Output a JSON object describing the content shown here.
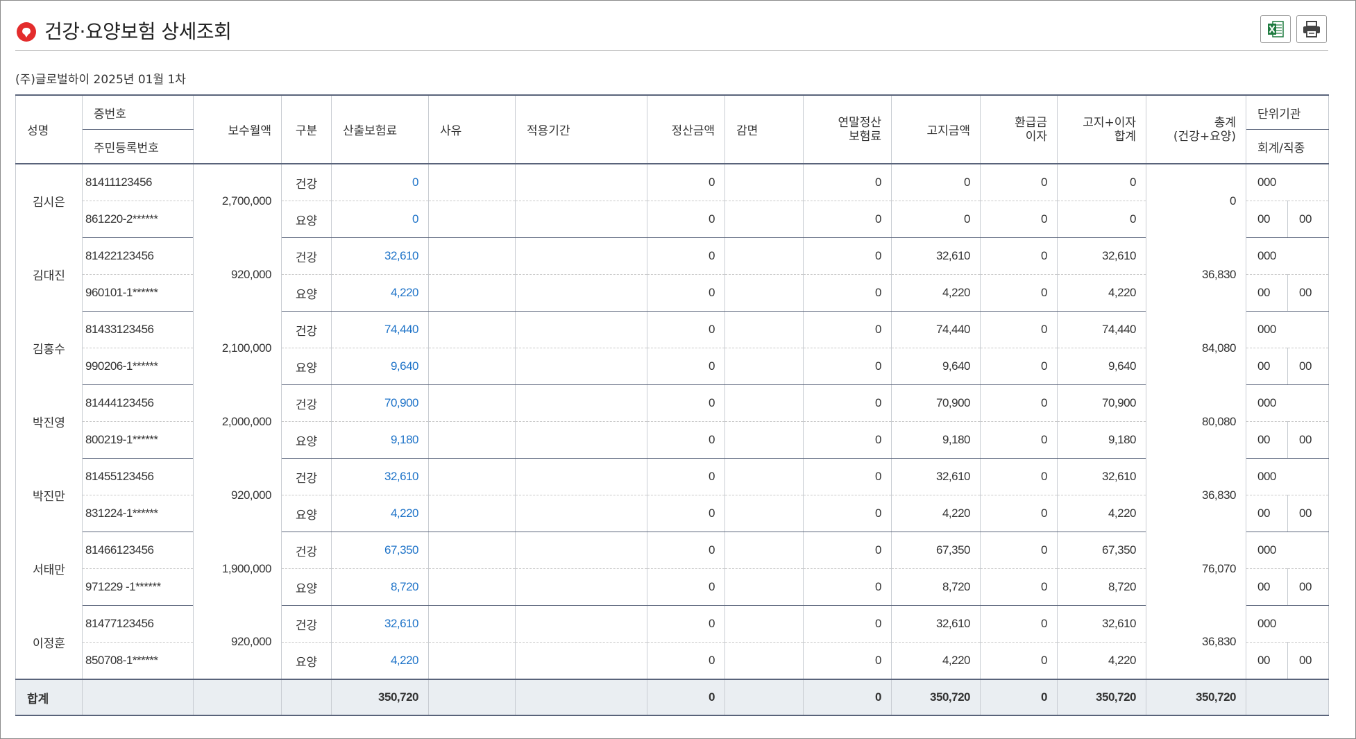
{
  "page": {
    "title": "건강·요양보험 상세조회",
    "subtitle": "(주)글로벌하이 2025년 01월 1차",
    "excel_label": "Excel",
    "print_label": "Print"
  },
  "headers": {
    "name": "성명",
    "card_no": "증번호",
    "resident_no": "주민등록번호",
    "monthly_pay": "보수월액",
    "category": "구분",
    "calc_premium": "산출보험료",
    "reason": "사유",
    "period": "적용기간",
    "settle_amount": "정산금액",
    "reduction": "감면",
    "yearend_l1": "연말정산",
    "yearend_l2": "보험료",
    "notice_amount": "고지금액",
    "refund_l1": "환급금",
    "refund_l2": "이자",
    "notice_interest_l1": "고지+이자",
    "notice_interest_l2": "합계",
    "total_l1": "총계",
    "total_l2": "(건강+요양)",
    "unit_org": "단위기관",
    "account_type": "회계/직종"
  },
  "rows": [
    {
      "name": "김시은",
      "card": "81411123456",
      "rrn": "861220-2******",
      "pay": "2,700,000",
      "h_cat": "건강",
      "h_calc": "0",
      "h_settle": "0",
      "h_year": "0",
      "h_notice": "0",
      "h_refund": "0",
      "h_sum": "0",
      "l_cat": "요양",
      "l_calc": "0",
      "l_settle": "0",
      "l_year": "0",
      "l_notice": "0",
      "l_refund": "0",
      "l_sum": "0",
      "total": "0",
      "unit": "000",
      "acc1": "00",
      "acc2": "00"
    },
    {
      "name": "김대진",
      "card": "81422123456",
      "rrn": "960101-1******",
      "pay": "920,000",
      "h_cat": "건강",
      "h_calc": "32,610",
      "h_settle": "0",
      "h_year": "0",
      "h_notice": "32,610",
      "h_refund": "0",
      "h_sum": "32,610",
      "l_cat": "요양",
      "l_calc": "4,220",
      "l_settle": "0",
      "l_year": "0",
      "l_notice": "4,220",
      "l_refund": "0",
      "l_sum": "4,220",
      "total": "36,830",
      "unit": "000",
      "acc1": "00",
      "acc2": "00"
    },
    {
      "name": "김홍수",
      "card": "81433123456",
      "rrn": "990206-1******",
      "pay": "2,100,000",
      "h_cat": "건강",
      "h_calc": "74,440",
      "h_settle": "0",
      "h_year": "0",
      "h_notice": "74,440",
      "h_refund": "0",
      "h_sum": "74,440",
      "l_cat": "요양",
      "l_calc": "9,640",
      "l_settle": "0",
      "l_year": "0",
      "l_notice": "9,640",
      "l_refund": "0",
      "l_sum": "9,640",
      "total": "84,080",
      "unit": "000",
      "acc1": "00",
      "acc2": "00"
    },
    {
      "name": "박진영",
      "card": "81444123456",
      "rrn": "800219-1******",
      "pay": "2,000,000",
      "h_cat": "건강",
      "h_calc": "70,900",
      "h_settle": "0",
      "h_year": "0",
      "h_notice": "70,900",
      "h_refund": "0",
      "h_sum": "70,900",
      "l_cat": "요양",
      "l_calc": "9,180",
      "l_settle": "0",
      "l_year": "0",
      "l_notice": "9,180",
      "l_refund": "0",
      "l_sum": "9,180",
      "total": "80,080",
      "unit": "000",
      "acc1": "00",
      "acc2": "00"
    },
    {
      "name": "박진만",
      "card": "81455123456",
      "rrn": "831224-1******",
      "pay": "920,000",
      "h_cat": "건강",
      "h_calc": "32,610",
      "h_settle": "0",
      "h_year": "0",
      "h_notice": "32,610",
      "h_refund": "0",
      "h_sum": "32,610",
      "l_cat": "요양",
      "l_calc": "4,220",
      "l_settle": "0",
      "l_year": "0",
      "l_notice": "4,220",
      "l_refund": "0",
      "l_sum": "4,220",
      "total": "36,830",
      "unit": "000",
      "acc1": "00",
      "acc2": "00"
    },
    {
      "name": "서태만",
      "card": "81466123456",
      "rrn": "971229 -1******",
      "pay": "1,900,000",
      "h_cat": "건강",
      "h_calc": "67,350",
      "h_settle": "0",
      "h_year": "0",
      "h_notice": "67,350",
      "h_refund": "0",
      "h_sum": "67,350",
      "l_cat": "요양",
      "l_calc": "8,720",
      "l_settle": "0",
      "l_year": "0",
      "l_notice": "8,720",
      "l_refund": "0",
      "l_sum": "8,720",
      "total": "76,070",
      "unit": "000",
      "acc1": "00",
      "acc2": "00"
    },
    {
      "name": "이정훈",
      "card": "81477123456",
      "rrn": "850708-1******",
      "pay": "920,000",
      "h_cat": "건강",
      "h_calc": "32,610",
      "h_settle": "0",
      "h_year": "0",
      "h_notice": "32,610",
      "h_refund": "0",
      "h_sum": "32,610",
      "l_cat": "요양",
      "l_calc": "4,220",
      "l_settle": "0",
      "l_year": "0",
      "l_notice": "4,220",
      "l_refund": "0",
      "l_sum": "4,220",
      "total": "36,830",
      "unit": "000",
      "acc1": "00",
      "acc2": "00"
    }
  ],
  "totals": {
    "label": "합계",
    "calc": "350,720",
    "settle": "0",
    "year": "0",
    "notice": "350,720",
    "refund": "0",
    "sum": "350,720",
    "total": "350,720"
  },
  "colors": {
    "accent_blue": "#1e73c8",
    "title_icon_red": "#e32c2c",
    "table_rule": "#59637a",
    "total_row_bg": "#eaeef2"
  }
}
